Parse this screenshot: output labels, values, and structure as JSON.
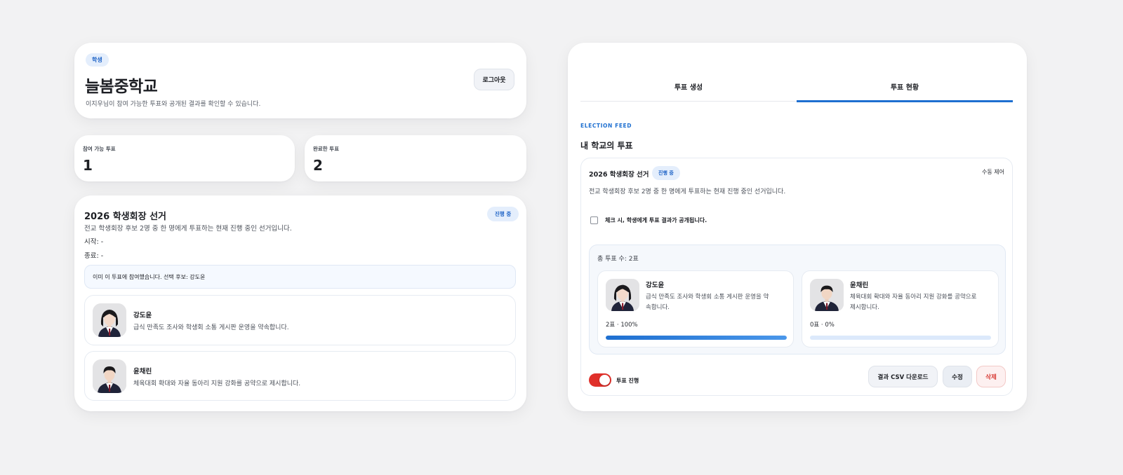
{
  "header": {
    "role_badge": "학생",
    "school_name": "늘봄중학교",
    "subtitle": "이지우님이 참여 가능한 투표와 공개된 결과를 확인할 수 있습니다.",
    "logout_label": "로그아웃"
  },
  "stats": {
    "available_label": "참여 가능 투표",
    "available_count": "1",
    "completed_label": "완료한 투표",
    "completed_count": "2"
  },
  "student_vote": {
    "title": "2026 학생회장 선거",
    "status": "진행 중",
    "description": "전교 학생회장 후보 2명 중 한 명에게 투표하는 현재 진행 중인 선거입니다.",
    "start": "시작: -",
    "end": "종료: -",
    "notice": "이미 이 투표에 참여했습니다. 선택 후보: 강도윤",
    "candidates": [
      {
        "name": "강도윤",
        "pledge": "급식 만족도 조사와 학생회 소통 게시판 운영을 약속합니다.",
        "avatar": "female-student-avatar"
      },
      {
        "name": "윤채린",
        "pledge": "체육대회 확대와 자율 동아리 지원 강화를 공약으로 제시합니다.",
        "avatar": "male-student-avatar"
      }
    ]
  },
  "admin": {
    "tabs": [
      {
        "label": "투표 생성",
        "active": false
      },
      {
        "label": "투표 현황",
        "active": true
      }
    ],
    "section_eyebrow": "ELECTION FEED",
    "section_title": "내 학교의 투표",
    "vote": {
      "title": "2026 학생회장 선거",
      "status": "진행 중",
      "control_mode": "수동 제어",
      "description": "전교 학생회장 후보 2명 중 한 명에게 투표하는 현재 진행 중인 선거입니다.",
      "publish_checkbox_label": "체크 시, 학생에게 투표 결과가 공개됩니다.",
      "publish_checked": false,
      "total_votes": "총 투표 수: 2표",
      "results": [
        {
          "name": "강도윤",
          "pledge_line1": "급식 만족도 조사와 학생회 소통 게시판 운영을 약",
          "pledge_line2": "속합니다.",
          "summary": "2표 · 100%",
          "share": 1.0
        },
        {
          "name": "윤채린",
          "pledge_line1": "체육대회 확대와 자율 동아리 지원 강화를 공약으로",
          "pledge_line2": "제시합니다.",
          "summary": "0표 · 0%",
          "share": 0.0
        }
      ],
      "toggle_label": "투표 진행",
      "toggle_on": true,
      "csv_button": "결과 CSV 다운로드",
      "edit_button": "수정",
      "delete_button": "삭제"
    }
  },
  "colors": {
    "accent": "#1e6fd0",
    "badge_bg": "#e4eefc",
    "toggle_on": "#e0302a",
    "delete_text": "#d83a34"
  }
}
